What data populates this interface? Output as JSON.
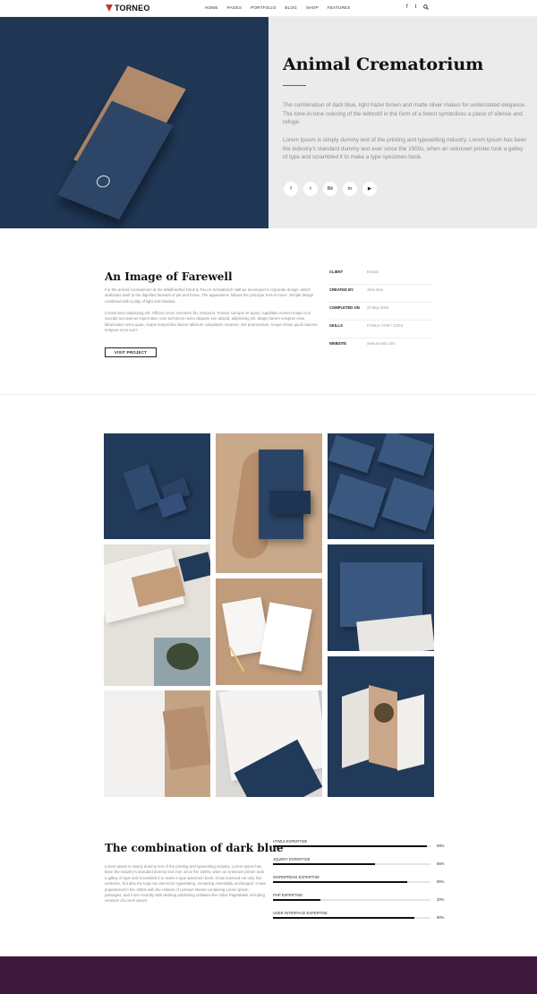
{
  "nav": {
    "logo": "TORNEO",
    "menu": [
      "HOME",
      "PAGES",
      "PORTFOLIO",
      "BLOG",
      "SHOP",
      "FEATURES"
    ],
    "icons": [
      "facebook-icon",
      "twitter-icon",
      "search-icon"
    ]
  },
  "hero": {
    "title": "Animal Crematorium",
    "p1": "The combination of dark blue, light hazel brown and matte silver makes for understated elegance. The tone-in-tone coloring of the leitmotif in the form of a forest symbolizes a place of silence and refuge.",
    "p2": "Lorem Ipsum is simply dummy text of the printing and typesetting industry. Lorem Ipsum has been the industry's standard dummy text ever since the 1500s, when an unknown printer took a galley of type and scrambled it to make a type specimen book.",
    "socials": [
      {
        "icon": "facebook-icon",
        "glyph": "f"
      },
      {
        "icon": "twitter-icon",
        "glyph": "t"
      },
      {
        "icon": "behance-icon",
        "glyph": "Bē"
      },
      {
        "icon": "linkedin-icon",
        "glyph": "in"
      },
      {
        "icon": "youtube-icon",
        "glyph": "▶"
      }
    ]
  },
  "details": {
    "title": "An Image of Farewell",
    "p1": "For the animal crematorium at the Waldfriedhof Dank & Treu in Schwäbisch Hall we developed a corporate design, which dedicates itself to the dignified farewell of pet and horse. The appearance follows the principle 'less is more'. Simple design combined with a play of light and shadow.",
    "p2": "Consectetur adipiscing elit. Officiar rerum inventore illo, temporia. Tenetur cumque sit quasi, cupiditate eveniet magni non suscipit accusamus expernatur, cum architecto nemo aliquam iure aliquid, adipisicing elit. Magni harum voluptas esse, laboriosam nemo quae, neque temporibus facere laborum voluptatem neutrum, sint praesentium, neque minus quod maiores tempore error iure?",
    "button": "VISIT PROJECT",
    "info": [
      {
        "label": "CLIENT",
        "value": "Envato"
      },
      {
        "label": "CREATED BY",
        "value": "John Doe"
      },
      {
        "label": "COMPLETED ON",
        "value": "22 May 2018"
      },
      {
        "label": "SKILLS",
        "value": "HTML5 / PHP / CSS3"
      },
      {
        "label": "WEBSITE",
        "value": "www.envato.com"
      }
    ]
  },
  "skills": {
    "title": "The combination of dark blue",
    "text": "Lorem Ipsum is simply dummy text of the printing and typesetting industry. Lorem Ipsum has been the industry's standard dummy text ever since the 1500s, when an unknown printer took a galley of type and scrambled it to make a type specimen book. It has survived not only five centuries, but also the leap into electronic typesetting, remaining essentially unchanged. It was popularised in the 1960s with the release of Letraset sheets containing Lorem Ipsum passages, and more recently with desktop publishing software like Aldus PageMaker including versions of Lorem Ipsum.",
    "items": [
      {
        "label": "HTML5 EXPERTISE",
        "value": 98,
        "pct": "98%"
      },
      {
        "label": "JQUERY EXPERTISE",
        "value": 65,
        "pct": "65%"
      },
      {
        "label": "WORDPRESS EXPERTISE",
        "value": 85,
        "pct": "85%"
      },
      {
        "label": "PHP EXPERTISE",
        "value": 30,
        "pct": "30%"
      },
      {
        "label": "USER INTERFACE EXPERTISE",
        "value": 90,
        "pct": "90%"
      }
    ]
  },
  "colors": {
    "accent": "#c0392b",
    "navy": "#203756",
    "footer": "#3d1a3d"
  }
}
